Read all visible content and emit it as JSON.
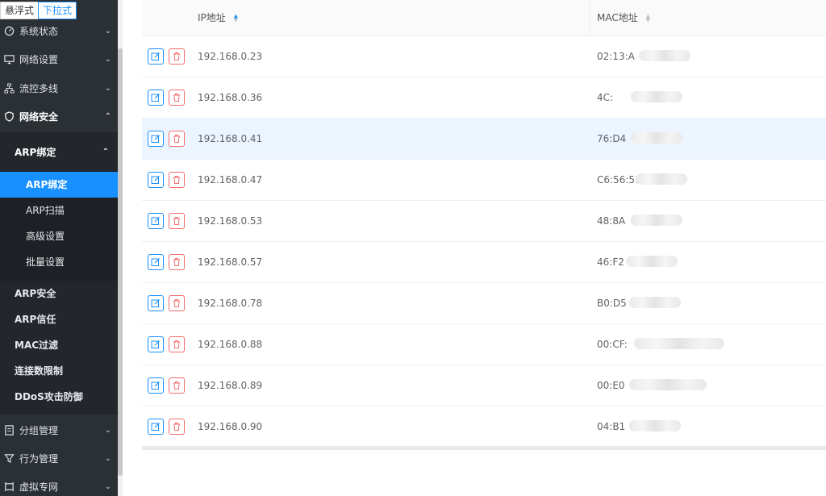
{
  "mode_switch": {
    "float": "悬浮式",
    "dropdown": "下拉式"
  },
  "sidebar": {
    "top_items": [
      {
        "label": "系统状态",
        "icon": "gauge-icon"
      },
      {
        "label": "网络设置",
        "icon": "monitor-icon"
      },
      {
        "label": "流控多线",
        "icon": "network-icon"
      },
      {
        "label": "网络安全",
        "icon": "shield-icon"
      }
    ],
    "group": "ARP绑定",
    "leaves": [
      "ARP绑定",
      "ARP扫描",
      "高级设置",
      "批量设置"
    ],
    "security_items": [
      "ARP安全",
      "ARP信任",
      "MAC过滤",
      "连接数限制",
      "DDoS攻击防御"
    ],
    "bottom_items": [
      {
        "label": "分组管理",
        "icon": "document-icon"
      },
      {
        "label": "行为管理",
        "icon": "filter-icon"
      },
      {
        "label": "虚拟专网",
        "icon": "vpn-icon"
      }
    ]
  },
  "table": {
    "headers": {
      "ip": "IP地址",
      "mac": "MAC地址"
    },
    "rows": [
      {
        "ip": "192.168.0.23",
        "mac": "02:13:A"
      },
      {
        "ip": "192.168.0.36",
        "mac": "4C:"
      },
      {
        "ip": "192.168.0.41",
        "mac": "76:D4"
      },
      {
        "ip": "192.168.0.47",
        "mac": "C6:56:51"
      },
      {
        "ip": "192.168.0.53",
        "mac": "48:8A"
      },
      {
        "ip": "192.168.0.57",
        "mac": "46:F2"
      },
      {
        "ip": "192.168.0.78",
        "mac": "B0:D5"
      },
      {
        "ip": "192.168.0.88",
        "mac": "00:CF:"
      },
      {
        "ip": "192.168.0.89",
        "mac": "00:E0"
      },
      {
        "ip": "192.168.0.90",
        "mac": "04:B1"
      }
    ]
  },
  "colors": {
    "accent": "#1890ff",
    "danger": "#f56c6c",
    "sidebar_bg": "#2b3035",
    "row_highlight": "#ecf5ff"
  }
}
